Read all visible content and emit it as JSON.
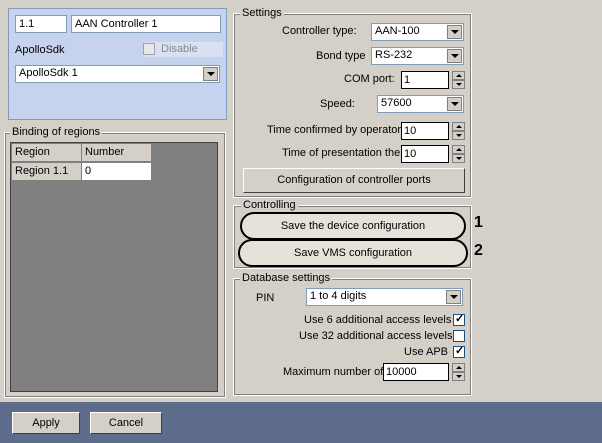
{
  "device": {
    "id": "1.1",
    "name": "AAN Controller 1",
    "parent_label": "ApolloSdk",
    "disable_label": "Disable",
    "parent_select": "ApolloSdk 1"
  },
  "regions": {
    "title": "Binding of regions",
    "columns": [
      "Region",
      "Number"
    ],
    "rows": [
      {
        "region": "Region 1.1",
        "number": "0"
      }
    ]
  },
  "settings": {
    "title": "Settings",
    "controller_type_label": "Controller type:",
    "controller_type": "AAN-100",
    "bond_type_label": "Bond type",
    "bond_type": "RS-232",
    "com_port_label": "COM port:",
    "com_port": "1",
    "speed_label": "Speed:",
    "speed": "57600",
    "time_confirmed_label": "Time confirmed by operator:",
    "time_confirmed": "10",
    "time_presentation_label": "Time of presentation the",
    "time_presentation": "10",
    "config_ports_button": "Configuration of controller ports"
  },
  "controlling": {
    "title": "Controlling",
    "save_device_button": "Save the device configuration",
    "save_vms_button": "Save VMS configuration",
    "callout_1": "1",
    "callout_2": "2"
  },
  "database": {
    "title": "Database settings",
    "pin_label": "PIN",
    "pin_value": "1 to 4 digits",
    "use6_label": "Use 6 additional access levels",
    "use6_checked": true,
    "use32_label": "Use 32 additional access levels",
    "use32_checked": false,
    "apb_label": "Use APB",
    "apb_checked": true,
    "max_number_label": "Maximum number of",
    "max_number": "10000"
  },
  "footer": {
    "apply_label": "Apply",
    "cancel_label": "Cancel"
  },
  "colors": {
    "panel": "#c6d3ef",
    "background": "#d4d0c8",
    "footer": "#5d6c8a"
  }
}
